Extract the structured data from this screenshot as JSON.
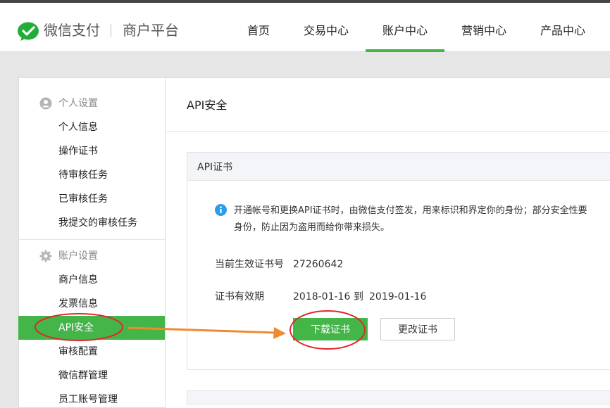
{
  "header": {
    "brand": "微信支付",
    "subtitle": "商户平台",
    "nav": [
      {
        "label": "首页"
      },
      {
        "label": "交易中心"
      },
      {
        "label": "账户中心",
        "active": true
      },
      {
        "label": "营销中心"
      },
      {
        "label": "产品中心"
      }
    ]
  },
  "sidebar": {
    "personal": {
      "heading": "个人设置",
      "icon": "user-icon",
      "items": [
        "个人信息",
        "操作证书",
        "待审核任务",
        "已审核任务",
        "我提交的审核任务"
      ]
    },
    "account": {
      "heading": "账户设置",
      "icon": "gear-icon",
      "items": [
        "商户信息",
        "发票信息",
        "API安全",
        "审核配置",
        "微信群管理",
        "员工账号管理"
      ],
      "active": "API安全"
    }
  },
  "main": {
    "title": "API安全",
    "panel": {
      "title": "API证书",
      "notice_line1": "开通帐号和更换API证书时，由微信支付签发，用来标识和界定你的身份；部分安全性要",
      "notice_line2": "身份，防止因为盗用而给你带来损失。",
      "cert_label": "当前生效证书号",
      "cert_value": "27260642",
      "validity_label": "证书有效期",
      "valid_from": "2018-01-16",
      "valid_to_word": "到",
      "valid_to": "2019-01-16",
      "download_button": "下载证书",
      "change_button": "更改证书"
    }
  },
  "colors": {
    "accent": "#44b549",
    "annotation_red": "#e0282a",
    "annotation_arrow": "#f08a30",
    "info_blue": "#2a9ee8"
  }
}
